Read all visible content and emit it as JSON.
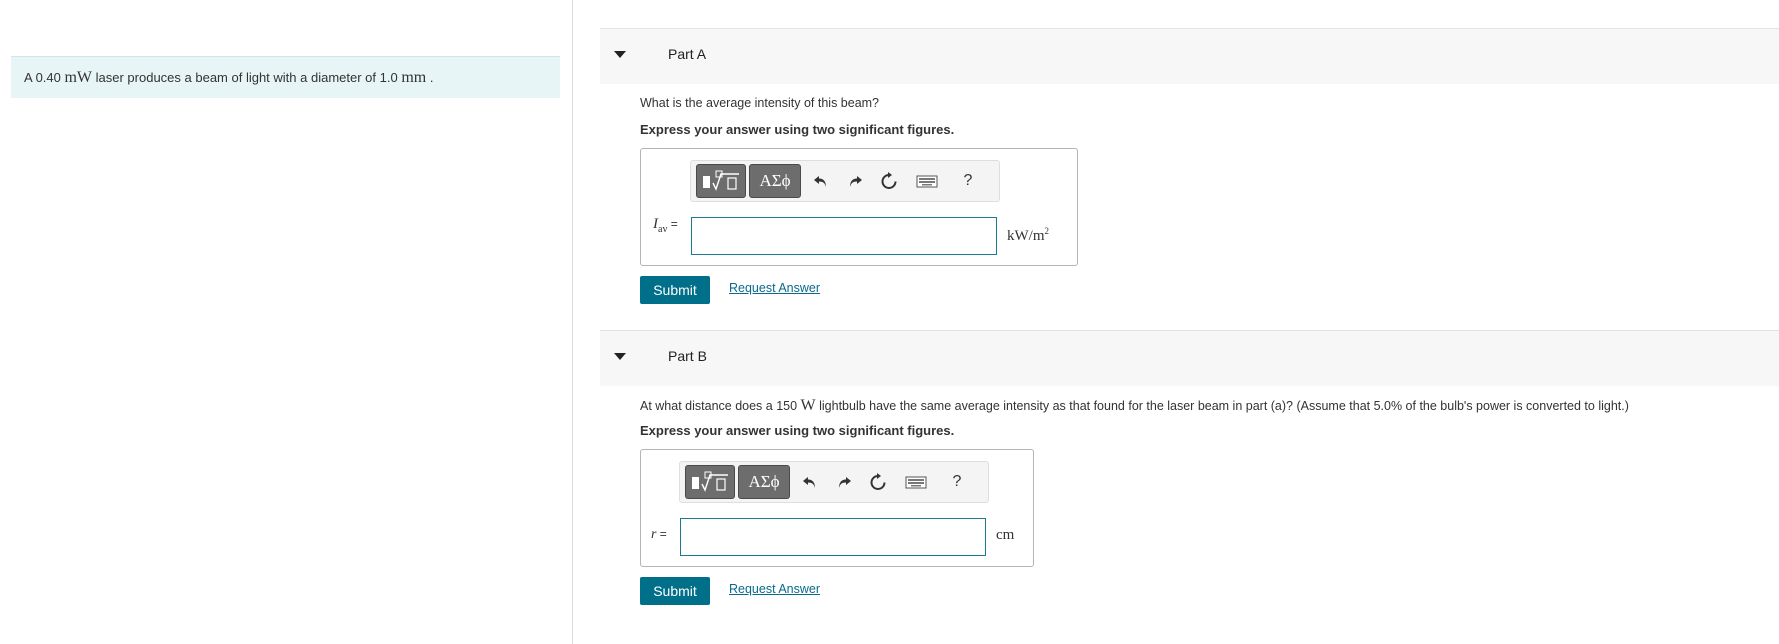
{
  "problem": {
    "text_before": "A 0.40 ",
    "power_unit": "mW",
    "text_middle": " laser produces a beam of light with a diameter of 1.0 ",
    "length_unit": "mm",
    "text_after": " ."
  },
  "toolbar": {
    "templates_icon": "template-icon",
    "greek_label": "ΑΣϕ",
    "undo_icon": "undo-icon",
    "redo_icon": "redo-icon",
    "reset_icon": "reset-icon",
    "keyboard_icon": "keyboard-icon",
    "help_label": "?"
  },
  "partA": {
    "title": "Part A",
    "question": "What is the average intensity of this beam?",
    "instruction": "Express your answer using two significant figures.",
    "var_symbol": "I",
    "var_subscript": "av",
    "equals": " =",
    "input_value": "",
    "unit_base": "kW/m",
    "unit_exp": "2",
    "submit_label": "Submit",
    "request_label": "Request Answer"
  },
  "partB": {
    "title": "Part B",
    "question_before": "At what distance does a 150 ",
    "question_unit": "W",
    "question_after": " lightbulb have the same average intensity as that found for the laser beam in part (a)? (Assume that 5.0% of the bulb's power is converted to light.)",
    "instruction": "Express your answer using two significant figures.",
    "var_symbol": "r",
    "equals": " =",
    "input_value": "",
    "unit": "cm",
    "submit_label": "Submit",
    "request_label": "Request Answer"
  }
}
